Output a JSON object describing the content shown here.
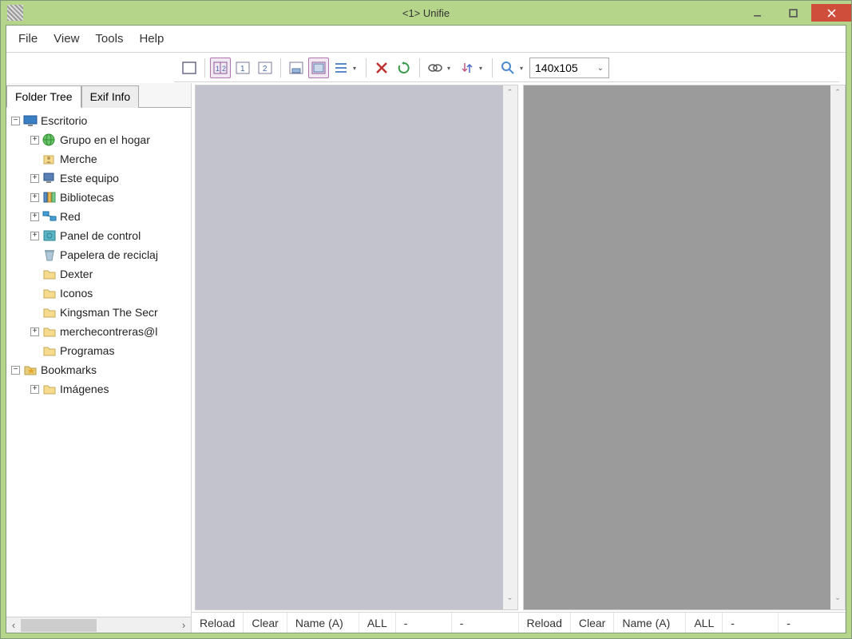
{
  "title": "<1> Unifie",
  "menu": {
    "file": "File",
    "view": "View",
    "tools": "Tools",
    "help": "Help"
  },
  "toolbar": {
    "size_value": "140x105"
  },
  "sidebar": {
    "tabs": {
      "folder_tree": "Folder Tree",
      "exif_info": "Exif Info"
    },
    "tree": [
      {
        "depth": 0,
        "exp": "-",
        "icon": "monitor",
        "label": "Escritorio"
      },
      {
        "depth": 1,
        "exp": "+",
        "icon": "globe",
        "label": "Grupo en el hogar"
      },
      {
        "depth": 1,
        "exp": " ",
        "icon": "user",
        "label": "Merche"
      },
      {
        "depth": 1,
        "exp": "+",
        "icon": "computer",
        "label": "Este equipo"
      },
      {
        "depth": 1,
        "exp": "+",
        "icon": "lib",
        "label": "Bibliotecas"
      },
      {
        "depth": 1,
        "exp": "+",
        "icon": "net",
        "label": "Red"
      },
      {
        "depth": 1,
        "exp": "+",
        "icon": "cpl",
        "label": "Panel de control"
      },
      {
        "depth": 1,
        "exp": " ",
        "icon": "bin",
        "label": "Papelera de reciclaj"
      },
      {
        "depth": 1,
        "exp": " ",
        "icon": "folder",
        "label": "Dexter"
      },
      {
        "depth": 1,
        "exp": " ",
        "icon": "folder",
        "label": "Iconos"
      },
      {
        "depth": 1,
        "exp": " ",
        "icon": "folder",
        "label": "Kingsman The Secr"
      },
      {
        "depth": 1,
        "exp": "+",
        "icon": "folder",
        "label": "merchecontreras@l"
      },
      {
        "depth": 1,
        "exp": " ",
        "icon": "folder",
        "label": "Programas"
      },
      {
        "depth": 0,
        "exp": "-",
        "icon": "bookmark",
        "label": "Bookmarks"
      },
      {
        "depth": 1,
        "exp": "+",
        "icon": "folder",
        "label": "Imágenes"
      }
    ]
  },
  "status": {
    "left": {
      "reload": "Reload",
      "clear": "Clear",
      "sort": "Name (A)",
      "filter": "ALL",
      "d1": "-",
      "d2": "-"
    },
    "right": {
      "reload": "Reload",
      "clear": "Clear",
      "sort": "Name (A)",
      "filter": "ALL",
      "d1": "-",
      "d2": "-"
    }
  }
}
